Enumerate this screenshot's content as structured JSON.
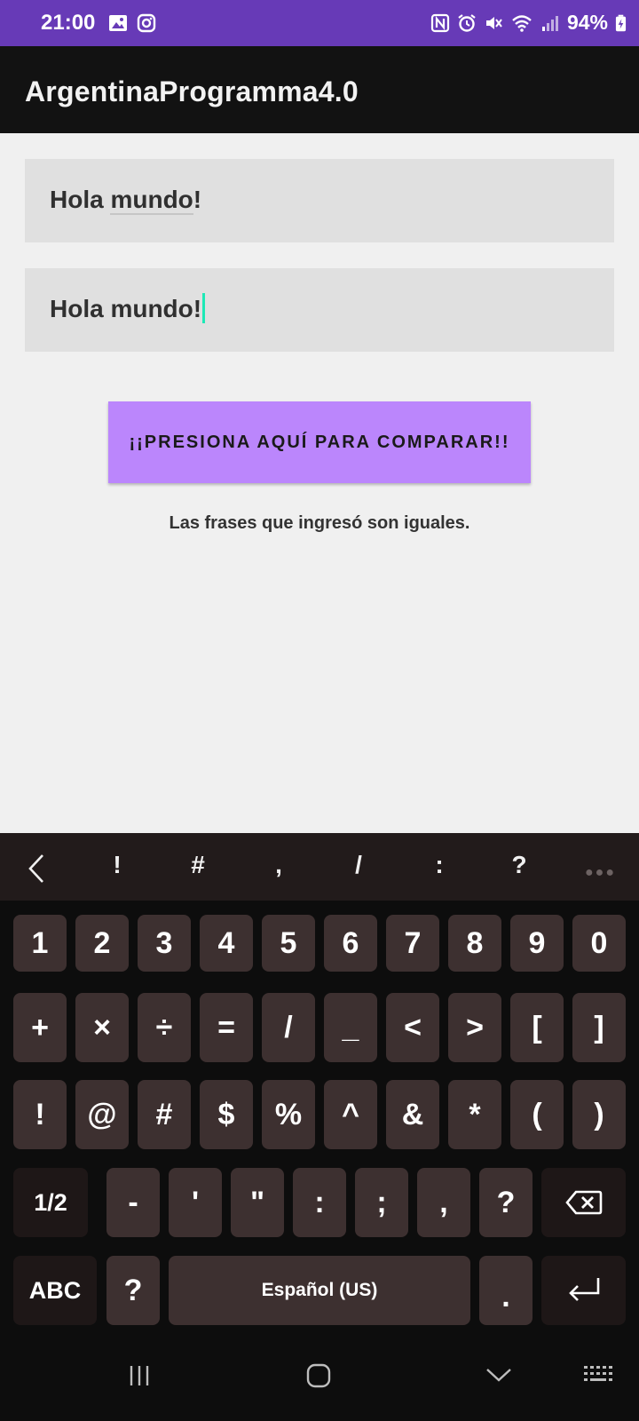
{
  "status_bar": {
    "time": "21:00",
    "battery": "94%",
    "icons": [
      "gallery-icon",
      "instagram-icon",
      "nfc-icon",
      "alarm-icon",
      "mute-icon",
      "wifi-icon",
      "signal-icon",
      "battery-charging-icon"
    ]
  },
  "app_bar": {
    "title": "ArgentinaProgramma4.0"
  },
  "form": {
    "field1": {
      "word1": "Hola",
      "word2": "mundo",
      "tail": "!"
    },
    "field2": {
      "value": "Hola mundo!"
    },
    "compare_button": "¡¡PRESIONA AQUÍ PARA COMPARAR!!",
    "result": "Las frases que ingresó son iguales."
  },
  "keyboard": {
    "toolbar": [
      "!",
      "#",
      ",",
      "/",
      ":",
      "?"
    ],
    "row1": [
      "1",
      "2",
      "3",
      "4",
      "5",
      "6",
      "7",
      "8",
      "9",
      "0"
    ],
    "row2": [
      "+",
      "×",
      "÷",
      "=",
      "/",
      "_",
      "<",
      ">",
      "[",
      "]"
    ],
    "row3": [
      "!",
      "@",
      "#",
      "$",
      "%",
      "^",
      "&",
      "*",
      "(",
      ")"
    ],
    "row4": {
      "page": "1/2",
      "keys": [
        "-",
        "'",
        "\"",
        ":",
        ";",
        ","
      ],
      "question": "?"
    },
    "row5": {
      "abc": "ABC",
      "question": "?",
      "space": "Español (US)",
      "period": "."
    }
  },
  "colors": {
    "status_bar": "#673ab7",
    "app_bar": "#121212",
    "button": "#bb86fc",
    "cursor": "#1de9b6",
    "key": "#3d3030"
  }
}
